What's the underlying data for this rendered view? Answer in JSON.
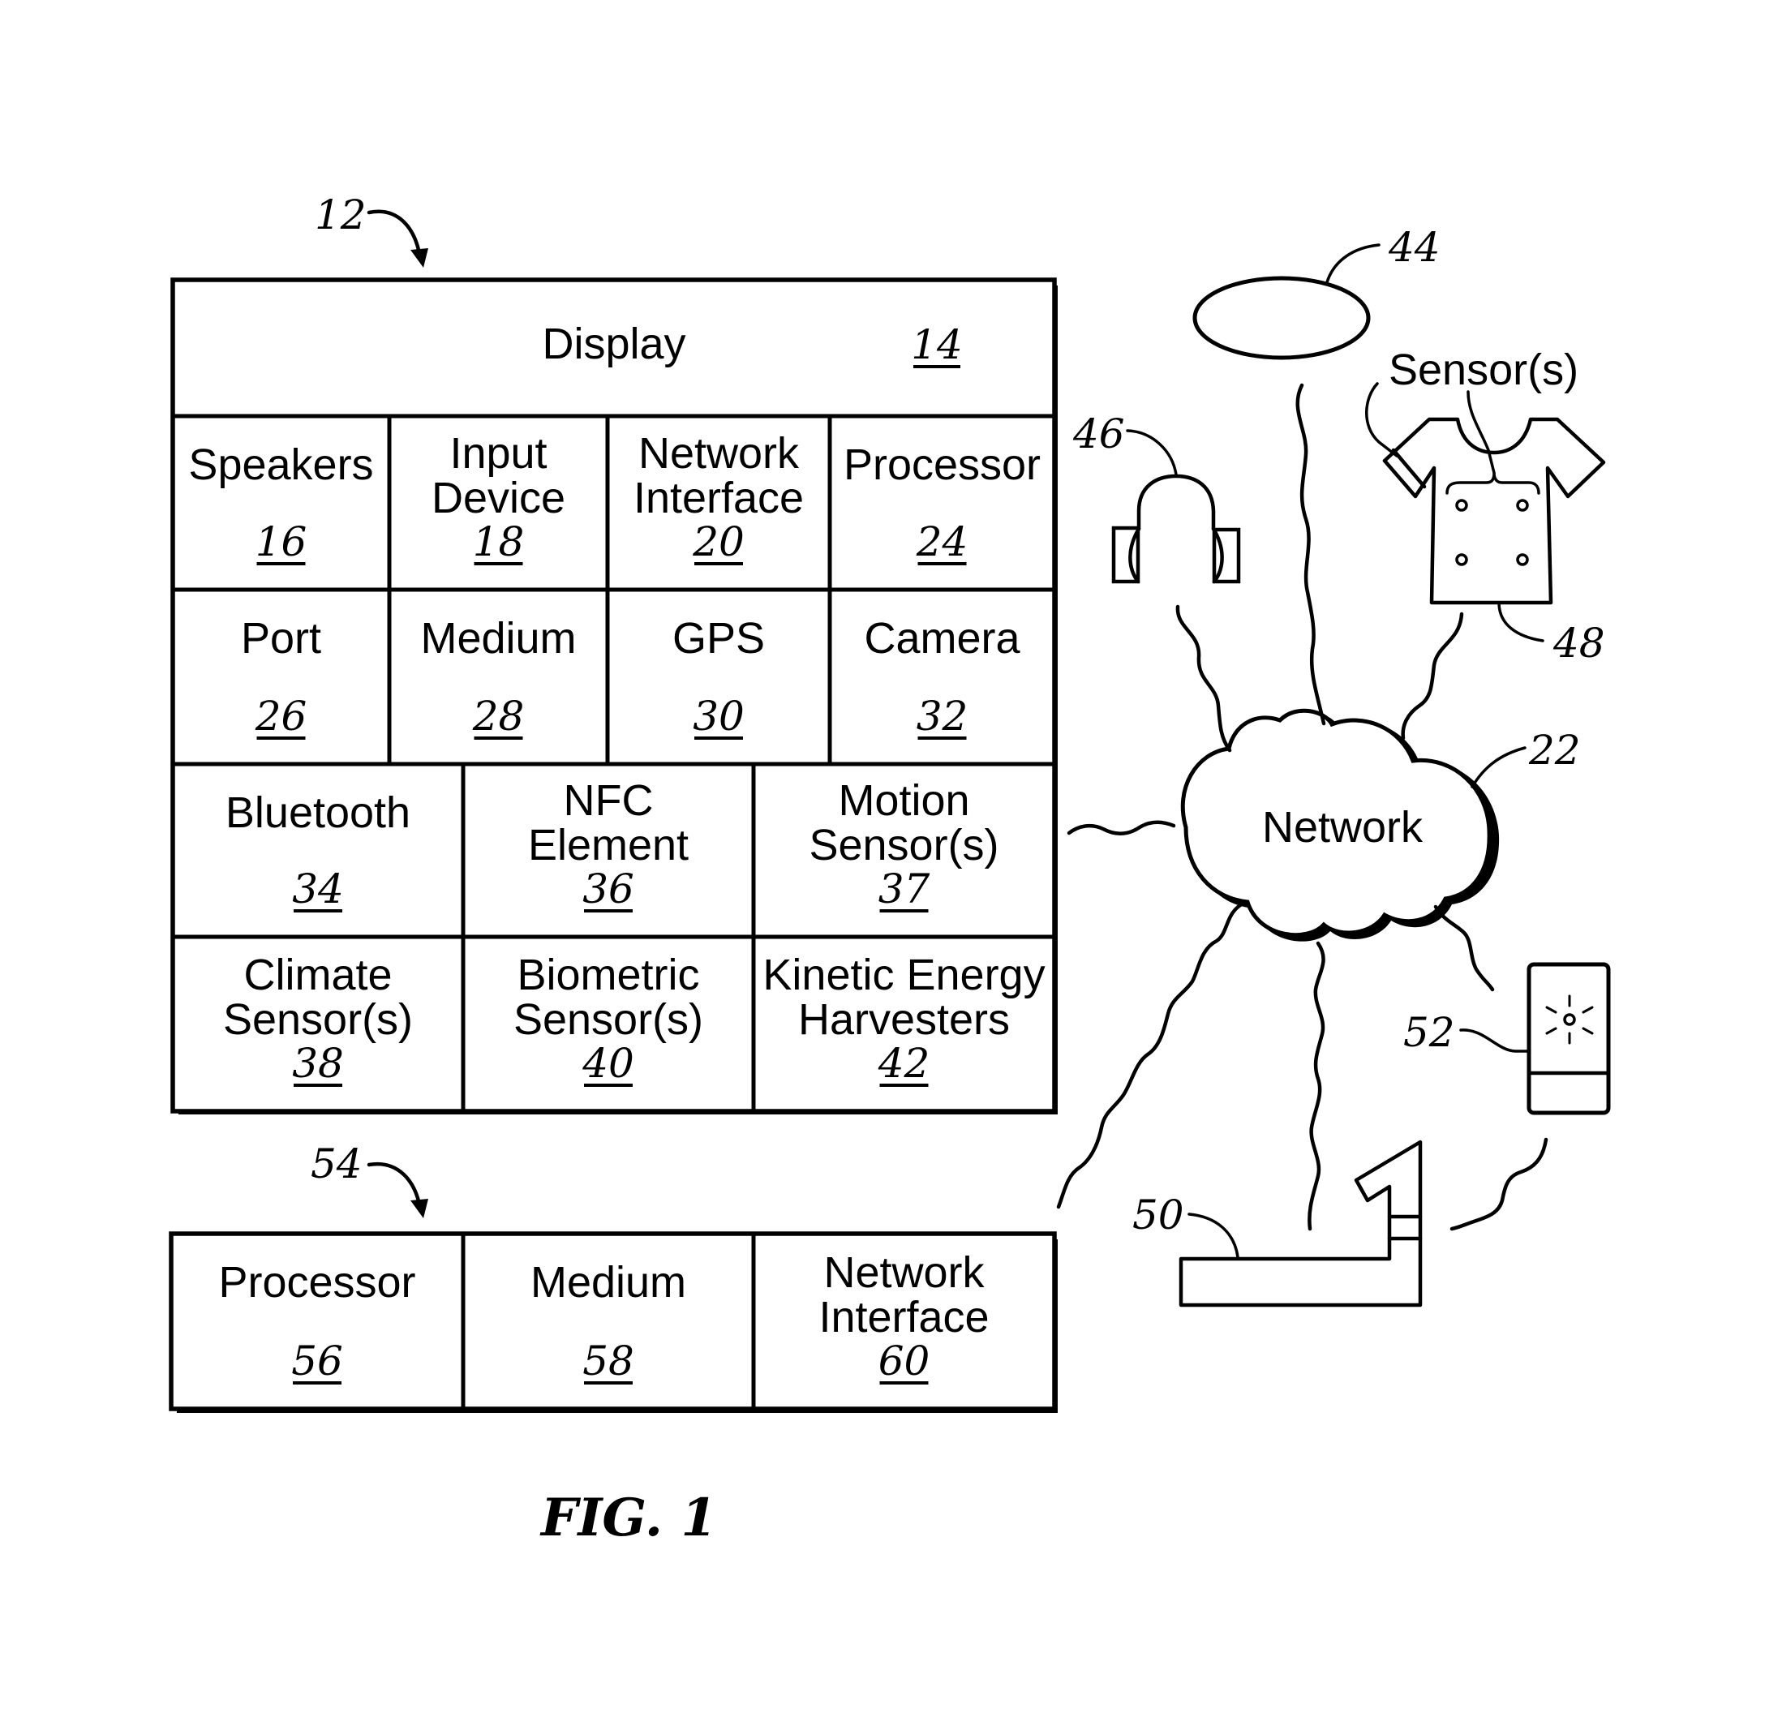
{
  "figure": {
    "caption": "FIG. 1",
    "device": {
      "ref": "12",
      "display": {
        "label": "Display",
        "ref": "14"
      },
      "rows": [
        [
          {
            "lines": [
              "Speakers"
            ],
            "ref": "16"
          },
          {
            "lines": [
              "Input",
              "Device"
            ],
            "ref": "18"
          },
          {
            "lines": [
              "Network",
              "Interface"
            ],
            "ref": "20"
          },
          {
            "lines": [
              "Processor"
            ],
            "ref": "24"
          }
        ],
        [
          {
            "lines": [
              "Port"
            ],
            "ref": "26"
          },
          {
            "lines": [
              "Medium"
            ],
            "ref": "28"
          },
          {
            "lines": [
              "GPS"
            ],
            "ref": "30"
          },
          {
            "lines": [
              "Camera"
            ],
            "ref": "32"
          }
        ],
        [
          {
            "lines": [
              "Bluetooth"
            ],
            "ref": "34"
          },
          {
            "lines": [
              "NFC",
              "Element"
            ],
            "ref": "36"
          },
          {
            "lines": [
              "Motion",
              "Sensor(s)"
            ],
            "ref": "37"
          }
        ],
        [
          {
            "lines": [
              "Climate",
              "Sensor(s)"
            ],
            "ref": "38"
          },
          {
            "lines": [
              "Biometric",
              "Sensor(s)"
            ],
            "ref": "40"
          },
          {
            "lines": [
              "Kinetic Energy",
              "Harvesters"
            ],
            "ref": "42"
          }
        ]
      ]
    },
    "server": {
      "ref": "54",
      "cells": [
        {
          "lines": [
            "Processor"
          ],
          "ref": "56"
        },
        {
          "lines": [
            "Medium"
          ],
          "ref": "58"
        },
        {
          "lines": [
            "Network",
            "Interface"
          ],
          "ref": "60"
        }
      ]
    },
    "network": {
      "label": "Network",
      "ref": "22"
    },
    "peripherals": {
      "headband": {
        "ref": "44",
        "icon": "headband-ellipse-icon"
      },
      "headphones": {
        "ref": "46",
        "icon": "headphones-icon"
      },
      "shirt": {
        "ref": "48",
        "icon": "shirt-icon",
        "sensor_label": "Sensor(s)"
      },
      "equipment": {
        "ref": "50",
        "icon": "exercise-equipment-icon"
      },
      "beacon": {
        "ref": "52",
        "icon": "light-device-icon"
      }
    }
  }
}
